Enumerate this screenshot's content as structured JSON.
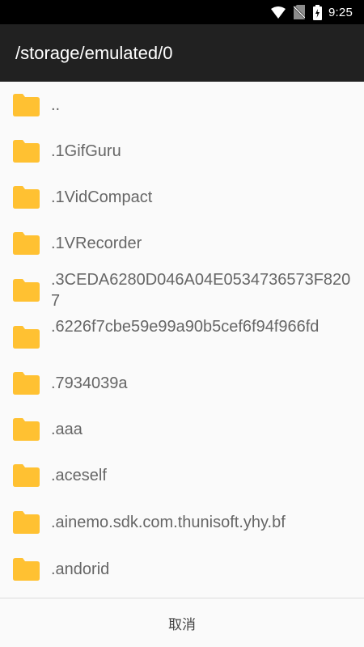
{
  "status_bar": {
    "time": "9:25"
  },
  "header": {
    "path": "/storage/emulated/0"
  },
  "files": [
    {
      "name": ".."
    },
    {
      "name": ".1GifGuru"
    },
    {
      "name": ".1VidCompact"
    },
    {
      "name": ".1VRecorder"
    },
    {
      "name": ".3CEDA6280D046A04E0534736573F8207"
    },
    {
      "name": ".6226f7cbe59e99a90b5cef6f94f966fd"
    },
    {
      "name": ".7934039a"
    },
    {
      "name": ".aaa"
    },
    {
      "name": ".aceself"
    },
    {
      "name": ".ainemo.sdk.com.thunisoft.yhy.bf"
    },
    {
      "name": ".andorid"
    }
  ],
  "footer": {
    "cancel_label": "取消"
  },
  "colors": {
    "folder": "#FFC132",
    "app_bar": "#212121",
    "status_bar": "#000000"
  }
}
